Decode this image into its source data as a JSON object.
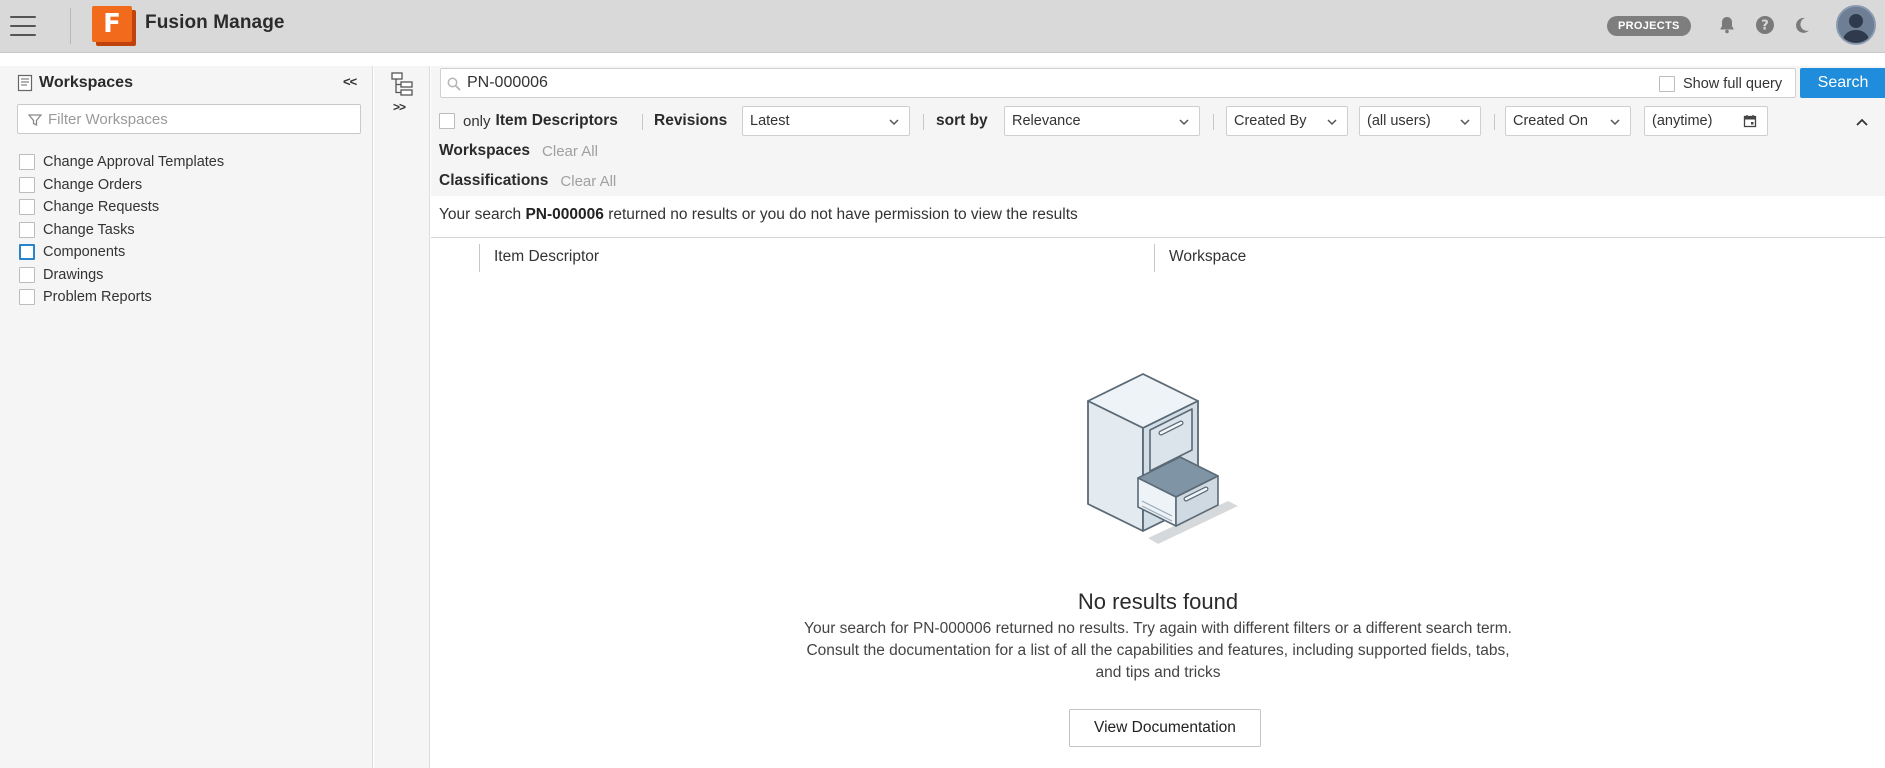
{
  "header": {
    "app_title": "Fusion Manage",
    "logo_letter": "F",
    "projects_label": "PROJECTS",
    "icons": [
      "hamburger-icon",
      "bell-icon",
      "help-icon",
      "moon-icon",
      "avatar"
    ]
  },
  "sidebar": {
    "title": "Workspaces",
    "collapse_label": "<<",
    "filter_placeholder": "Filter Workspaces",
    "items": [
      {
        "label": "Change Approval Templates",
        "checked": false
      },
      {
        "label": "Change Orders",
        "checked": false
      },
      {
        "label": "Change Requests",
        "checked": false
      },
      {
        "label": "Change Tasks",
        "checked": false
      },
      {
        "label": "Components",
        "checked": false,
        "focused": true
      },
      {
        "label": "Drawings",
        "checked": false
      },
      {
        "label": "Problem Reports",
        "checked": false
      }
    ]
  },
  "tree": {
    "expand_label": ">>"
  },
  "search": {
    "query": "PN-000006",
    "show_full_query_label": "Show full query",
    "button_label": "Search"
  },
  "filters": {
    "only_label": "only",
    "item_descriptors_label": "Item Descriptors",
    "revisions_label": "Revisions",
    "revisions_value": "Latest",
    "sort_by_label": "sort by",
    "sort_by_value": "Relevance",
    "created_by_label": "Created By",
    "users_value": "(all users)",
    "created_on_label": "Created On",
    "time_value": "(anytime)"
  },
  "facets": {
    "workspaces_label": "Workspaces",
    "classifications_label": "Classifications",
    "clear_all": "Clear All"
  },
  "results": {
    "message_prefix": "Your search",
    "message_query": "PN-000006",
    "message_suffix": "returned no results or you do not have permission to view the results",
    "columns": [
      "Item Descriptor",
      "Workspace"
    ]
  },
  "empty_state": {
    "title": "No results found",
    "lines": [
      "Your search for PN-000006 returned no results. Try again with different filters or a different search term.",
      "Consult the documentation for a list of all the capabilities and features, including supported fields, tabs,",
      "and tips and tricks"
    ],
    "button_label": "View Documentation"
  },
  "colors": {
    "accent": "#1f8ddb",
    "logo_orange": "#f26a1b",
    "header_bg": "#d9d9d9"
  }
}
